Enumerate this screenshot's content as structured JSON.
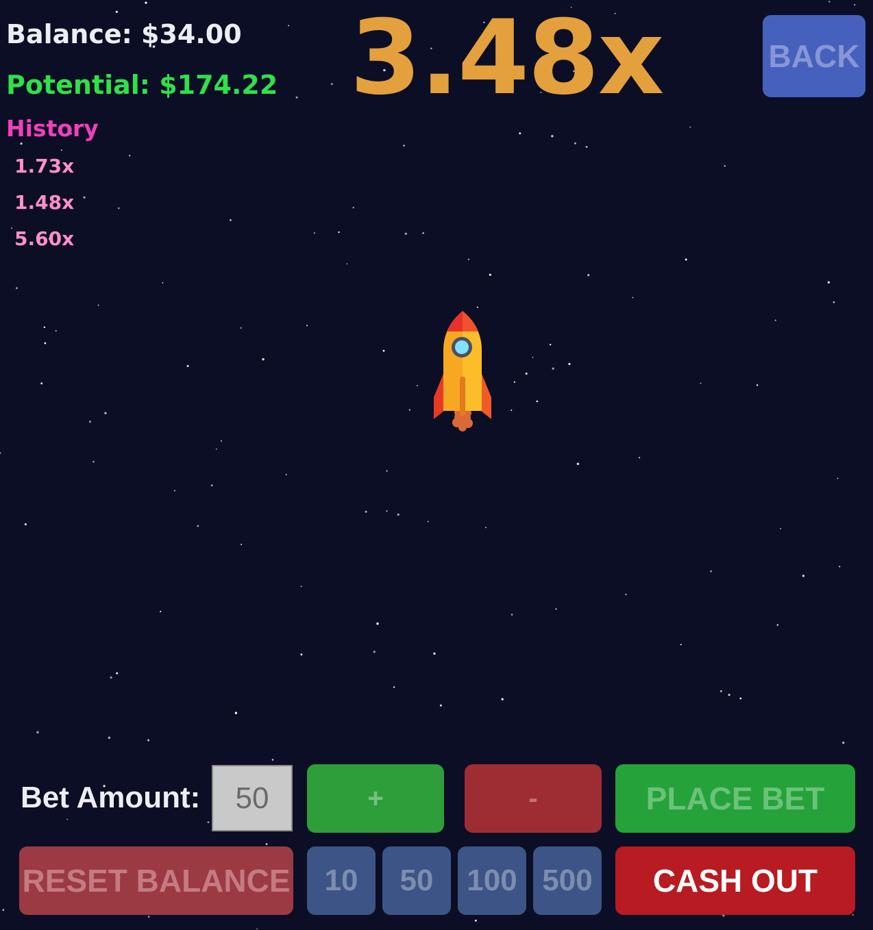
{
  "header": {
    "balance": "Balance: $34.00",
    "potential": "Potential: $174.22",
    "multiplier": "3.48x",
    "back_label": "BACK"
  },
  "history": {
    "title": "History",
    "items": [
      "1.73x",
      "1.48x",
      "5.60x"
    ]
  },
  "controls": {
    "bet_label": "Bet Amount:",
    "bet_value": "50",
    "plus_label": "+",
    "minus_label": "-",
    "place_bet_label": "PLACE BET",
    "reset_balance_label": "RESET BALANCE",
    "chips": [
      "10",
      "50",
      "100",
      "500"
    ],
    "cash_out_label": "CASH OUT"
  },
  "colors": {
    "background": "#0c0e25",
    "multiplier": "#e4a03c",
    "potential": "#2fe04a",
    "history_title": "#f23fba",
    "history_items": "#ff8fc9",
    "back_button": "#4661bd",
    "plus_button": "#2d9e39",
    "minus_button": "#9e2d33",
    "place_bet_button": "#25a23a",
    "reset_button": "#9c3a43",
    "chip_button": "#3c5486",
    "cash_out_button": "#b81b21"
  },
  "icons": {
    "player": "rocket-icon"
  }
}
